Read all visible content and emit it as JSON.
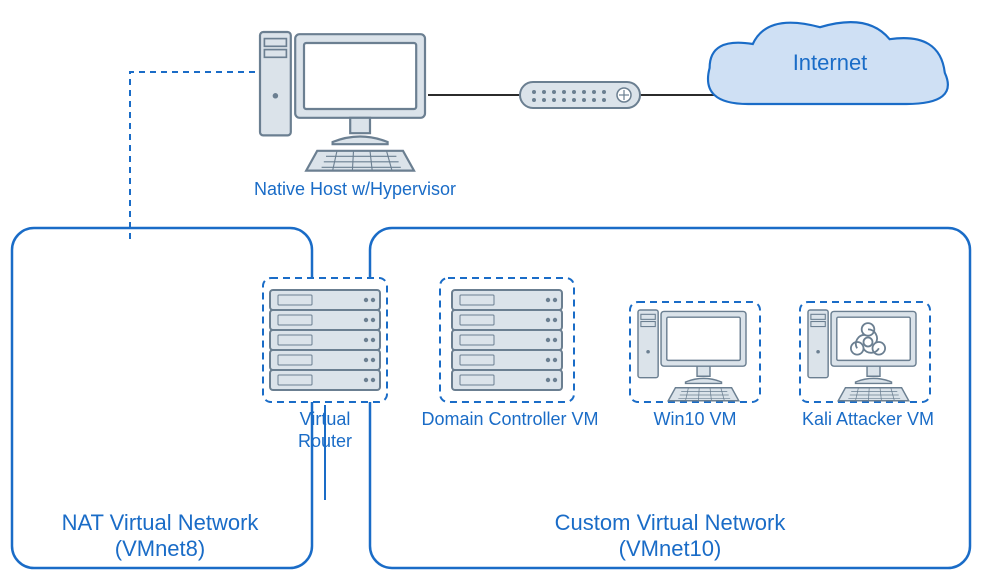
{
  "diagram": {
    "cloud_label": "Internet",
    "host_label": "Native Host w/Hypervisor",
    "nat_network_title_line1": "NAT Virtual Network",
    "nat_network_title_line2": "(VMnet8)",
    "custom_network_title_line1": "Custom Virtual Network",
    "custom_network_title_line2": "(VMnet10)",
    "virtual_router_label_line1": "Virtual",
    "virtual_router_label_line2": "Router",
    "dc_vm_label": "Domain Controller VM",
    "win10_vm_label": "Win10 VM",
    "kali_vm_label": "Kali Attacker VM"
  }
}
